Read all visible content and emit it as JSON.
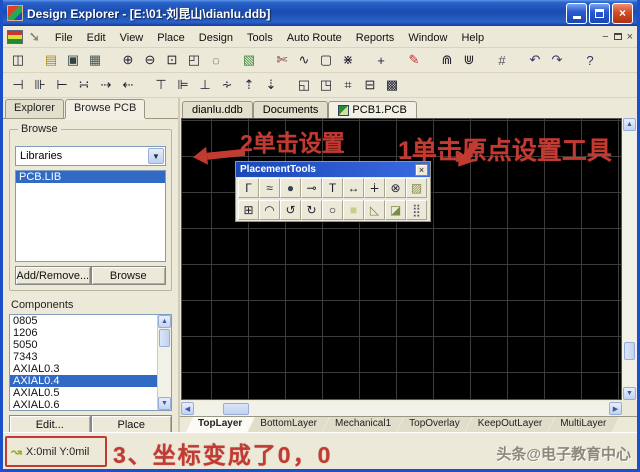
{
  "window": {
    "title": "Design Explorer - [E:\\01-刘昆山\\dianlu.ddb]"
  },
  "menu": {
    "items": [
      "File",
      "Edit",
      "View",
      "Place",
      "Design",
      "Tools",
      "Auto Route",
      "Reports",
      "Window",
      "Help"
    ]
  },
  "toolbar_main": [
    {
      "name": "design-manager-icon",
      "glyph": "◫"
    },
    {
      "name": "open-document-icon",
      "glyph": "▤",
      "color": "#b08a20",
      "gap": true
    },
    {
      "name": "save-icon",
      "glyph": "▣",
      "color": "#344"
    },
    {
      "name": "print-icon",
      "glyph": "▦",
      "color": "#455"
    },
    {
      "name": "zoom-in-icon",
      "glyph": "⊕",
      "gap": true
    },
    {
      "name": "zoom-out-icon",
      "glyph": "⊖"
    },
    {
      "name": "zoom-window-icon",
      "glyph": "⊡"
    },
    {
      "name": "zoom-document-icon",
      "glyph": "◰"
    },
    {
      "name": "zoom-point-icon",
      "glyph": "◌"
    },
    {
      "name": "browse-library-icon",
      "glyph": "▧",
      "color": "#3d8f3d",
      "gap": true
    },
    {
      "name": "knife-icon",
      "glyph": "✄",
      "color": "#733",
      "gap": true
    },
    {
      "name": "curve-icon",
      "glyph": "∿"
    },
    {
      "name": "selection-icon",
      "glyph": "▢"
    },
    {
      "name": "cross-probe-icon",
      "glyph": "⋇"
    },
    {
      "name": "move-icon",
      "glyph": "+",
      "color": "#224",
      "gap": true
    },
    {
      "name": "highlight-pen-icon",
      "glyph": "✎",
      "color": "#b33",
      "gap": true
    },
    {
      "name": "library-components-icon",
      "glyph": "⋒",
      "gap": true
    },
    {
      "name": "library-update-icon",
      "glyph": "⋓"
    },
    {
      "name": "grid-icon",
      "glyph": "#",
      "color": "#556",
      "gap": true
    },
    {
      "name": "undo-icon",
      "glyph": "↶",
      "color": "#336",
      "gap": true
    },
    {
      "name": "redo-icon",
      "glyph": "↷",
      "color": "#336"
    },
    {
      "name": "help-icon",
      "glyph": "?",
      "color": "#336",
      "gap": true
    }
  ],
  "toolbar_align": [
    {
      "name": "align-left-icon",
      "glyph": "⊣"
    },
    {
      "name": "center-horizontal-icon",
      "glyph": "⊪"
    },
    {
      "name": "align-right-icon",
      "glyph": "⊢"
    },
    {
      "name": "equal-horizontal-spacing-icon",
      "glyph": "∺"
    },
    {
      "name": "increase-horizontal-spacing-icon",
      "glyph": "⇢"
    },
    {
      "name": "decrease-horizontal-spacing-icon",
      "glyph": "⇠"
    },
    {
      "name": "align-top-icon",
      "glyph": "⊤",
      "gap": true
    },
    {
      "name": "center-vertical-icon",
      "glyph": "⊫"
    },
    {
      "name": "align-bottom-icon",
      "glyph": "⊥"
    },
    {
      "name": "equal-vertical-spacing-icon",
      "glyph": "∻"
    },
    {
      "name": "increase-vertical-spacing-icon",
      "glyph": "⇡"
    },
    {
      "name": "decrease-vertical-spacing-icon",
      "glyph": "⇣"
    },
    {
      "name": "arrange-inside-room-icon",
      "glyph": "◱",
      "gap": true
    },
    {
      "name": "arrange-outside-room-icon",
      "glyph": "◳"
    },
    {
      "name": "align-to-grid-icon",
      "glyph": "⌗"
    },
    {
      "name": "space-components-icon",
      "glyph": "⊟"
    },
    {
      "name": "placement-array-icon",
      "glyph": "▩"
    }
  ],
  "sidebar": {
    "tabs": [
      {
        "label": "Explorer"
      },
      {
        "label": "Browse PCB",
        "active": true
      }
    ],
    "browse": {
      "legend": "Browse",
      "selector_value": "Libraries",
      "libraries": [
        {
          "label": "PCB.LIB",
          "selected": true
        }
      ],
      "add_remove_label": "Add/Remove...",
      "browse_label": "Browse"
    },
    "components": {
      "label": "Components",
      "items": [
        {
          "label": "0805"
        },
        {
          "label": "1206"
        },
        {
          "label": "5050"
        },
        {
          "label": "7343"
        },
        {
          "label": "AXIAL0.3"
        },
        {
          "label": "AXIAL0.4",
          "selected": true
        },
        {
          "label": "AXIAL0.5"
        },
        {
          "label": "AXIAL0.6"
        }
      ],
      "edit_label": "Edit...",
      "place_label": "Place"
    }
  },
  "document_tabs": [
    {
      "label": "dianlu.ddb"
    },
    {
      "label": "Documents"
    },
    {
      "label": "PCB1.PCB",
      "active": true
    }
  ],
  "placement_tools": {
    "title": "PlacementTools",
    "row1": [
      {
        "name": "place-track-icon",
        "glyph": "Γ"
      },
      {
        "name": "place-keepout-icon",
        "glyph": "≈"
      },
      {
        "name": "place-via-icon",
        "glyph": "●",
        "color": "#345"
      },
      {
        "name": "place-pad-icon",
        "glyph": "⊸"
      },
      {
        "name": "place-string-icon",
        "glyph": "T"
      },
      {
        "name": "place-dimension-icon",
        "glyph": "↔"
      },
      {
        "name": "place-coordinate-icon",
        "glyph": "∔"
      },
      {
        "name": "set-origin-icon",
        "glyph": "⊗"
      },
      {
        "name": "place-fill-hatch-icon",
        "glyph": "▨",
        "color": "#8a8a4a"
      }
    ],
    "row2": [
      {
        "name": "paste-array-icon",
        "glyph": "⊞"
      },
      {
        "name": "arc-edge-icon",
        "glyph": "◠"
      },
      {
        "name": "arc-center-icon",
        "glyph": "↺"
      },
      {
        "name": "arc-angle-icon",
        "glyph": "↻"
      },
      {
        "name": "full-circle-icon",
        "glyph": "○"
      },
      {
        "name": "place-fill-icon",
        "glyph": "■",
        "color": "#c2d08a"
      },
      {
        "name": "polygon-plane-icon",
        "glyph": "◺",
        "color": "#7a8a4a"
      },
      {
        "name": "split-plane-icon",
        "glyph": "◪",
        "color": "#7a8a4a"
      },
      {
        "name": "pad-array-icon",
        "glyph": "⣿",
        "color": "#556"
      }
    ]
  },
  "layer_tabs": [
    {
      "label": "TopLayer",
      "active": true
    },
    {
      "label": "BottomLayer"
    },
    {
      "label": "Mechanical1"
    },
    {
      "label": "TopOverlay"
    },
    {
      "label": "KeepOutLayer"
    },
    {
      "label": "MultiLayer"
    }
  ],
  "annotations": {
    "accent": "#c23b32",
    "step1": "1单击原点设置工具",
    "step2": "2单击设置",
    "step3": "3、坐标变成了0，0"
  },
  "status": {
    "coords": "X:0mil Y:0mil"
  },
  "watermark": "头条@电子教育中心"
}
